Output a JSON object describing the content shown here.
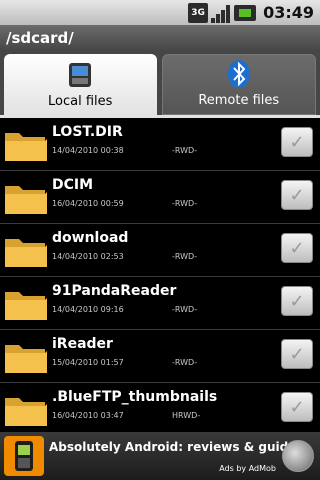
{
  "status_bar": {
    "network": "3G",
    "time": "03:49",
    "icons": [
      "3g-icon",
      "signal-icon",
      "battery-icon"
    ]
  },
  "path": "/sdcard/",
  "tabs": [
    {
      "label": "Local files",
      "icon": "device-icon",
      "active": true
    },
    {
      "label": "Remote files",
      "icon": "bluetooth-icon",
      "active": false
    }
  ],
  "files": [
    {
      "name": "LOST.DIR",
      "date": "14/04/2010 00:38",
      "perm": "-RWD-",
      "icon": "folder-icon"
    },
    {
      "name": "DCIM",
      "date": "16/04/2010 00:59",
      "perm": "-RWD-",
      "icon": "folder-icon"
    },
    {
      "name": "download",
      "date": "14/04/2010 02:53",
      "perm": "-RWD-",
      "icon": "folder-icon"
    },
    {
      "name": "91PandaReader",
      "date": "14/04/2010 09:16",
      "perm": "-RWD-",
      "icon": "folder-icon"
    },
    {
      "name": "iReader",
      "date": "15/04/2010 01:57",
      "perm": "-RWD-",
      "icon": "folder-icon"
    },
    {
      "name": ".BlueFTP_thumbnails",
      "date": "16/04/2010 03:47",
      "perm": "HRWD-",
      "icon": "folder-icon"
    }
  ],
  "ad": {
    "title": "Absolutely Android: reviews & guide",
    "subtitle": "Ads by AdMob",
    "icon": "phone-icon",
    "action_icon": "globe-icon"
  },
  "colors": {
    "accent_orange": "#f08a00",
    "battery_green": "#58c022",
    "folder_yellow": "#f4c24c"
  }
}
